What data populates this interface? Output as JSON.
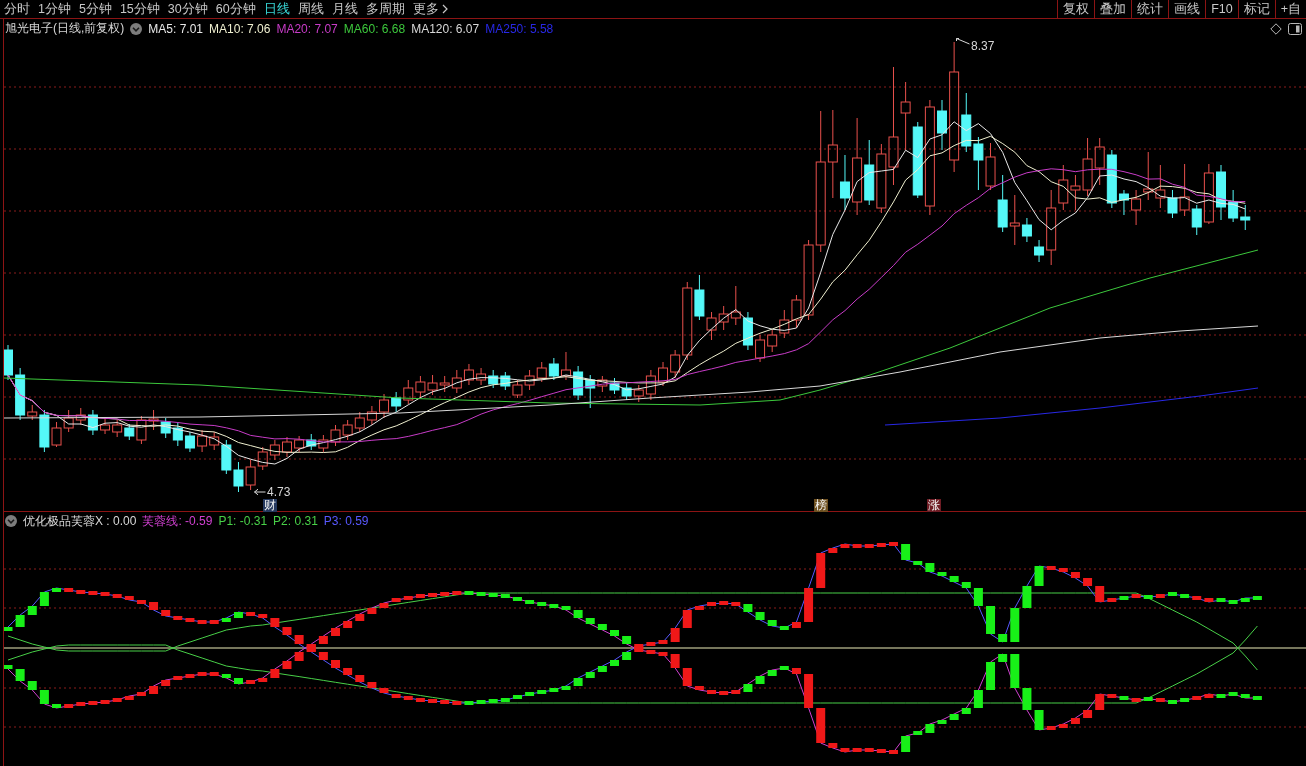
{
  "toolbar": {
    "periods": [
      {
        "label": "分时",
        "kind": "period",
        "selected": false
      },
      {
        "label": "1分钟",
        "kind": "period",
        "selected": false
      },
      {
        "label": "5分钟",
        "kind": "period",
        "selected": false
      },
      {
        "label": "15分钟",
        "kind": "period",
        "selected": false
      },
      {
        "label": "30分钟",
        "kind": "period",
        "selected": false
      },
      {
        "label": "60分钟",
        "kind": "period",
        "selected": false
      },
      {
        "label": "日线",
        "kind": "period",
        "selected": true
      },
      {
        "label": "周线",
        "kind": "period",
        "selected": false
      },
      {
        "label": "月线",
        "kind": "period",
        "selected": false
      },
      {
        "label": "多周期",
        "kind": "period",
        "selected": false
      },
      {
        "label": "更多",
        "kind": "menu",
        "selected": false
      }
    ],
    "buttons": [
      "复权",
      "叠加",
      "统计",
      "画线",
      "F10",
      "标记",
      "+自"
    ]
  },
  "main_chart": {
    "title": "旭光电子(日线,前复权)",
    "moving_averages": [
      {
        "label": "MA5: 7.01",
        "color": "#e8e8e8"
      },
      {
        "label": "MA10: 7.06",
        "color": "#f0f0d0"
      },
      {
        "label": "MA20: 7.07",
        "color": "#c83cc8"
      },
      {
        "label": "MA60: 6.68",
        "color": "#3cc83c"
      },
      {
        "label": "MA120: 6.07",
        "color": "#d8d8d8"
      },
      {
        "label": "MA250: 5.58",
        "color": "#2828e6"
      }
    ],
    "high_label": "8.37",
    "low_label": "4.73",
    "event_markers": [
      {
        "text": "财",
        "color": "#24385e"
      },
      {
        "text": "榜",
        "color": "#6e5020"
      },
      {
        "text": "涨",
        "color": "#6e1c24"
      }
    ]
  },
  "indicator": {
    "title": "优化极品芙蓉X : 0.00",
    "values": [
      {
        "label": "芙蓉线: -0.59",
        "color": "#d040d0"
      },
      {
        "label": "P1: -0.31",
        "color": "#48d048"
      },
      {
        "label": "P2: 0.31",
        "color": "#48d048"
      },
      {
        "label": "P3: 0.59",
        "color": "#5858ff"
      }
    ]
  }
}
